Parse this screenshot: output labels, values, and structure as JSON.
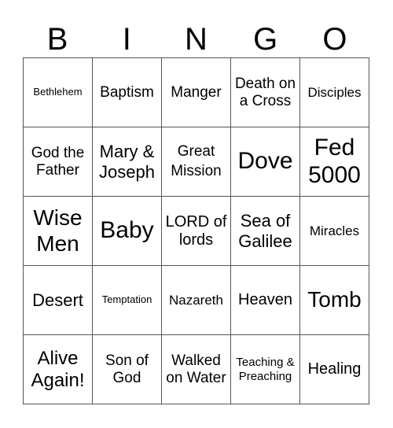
{
  "header": [
    "B",
    "I",
    "N",
    "G",
    "O"
  ],
  "cells": [
    [
      "Bethlehem",
      "Baptism",
      "Manger",
      "Death on a Cross",
      "Disciples"
    ],
    [
      "God the Father",
      "Mary & Joseph",
      "Great Mission",
      "Dove",
      "Fed 5000"
    ],
    [
      "Wise Men",
      "Baby",
      "LORD of lords",
      "Sea of Galilee",
      "Miracles"
    ],
    [
      "Desert",
      "Temptation",
      "Nazareth",
      "Heaven",
      "Tomb"
    ],
    [
      "Alive Again!",
      "Son of God",
      "Walked on Water",
      "Teaching & Preaching",
      "Healing"
    ]
  ]
}
